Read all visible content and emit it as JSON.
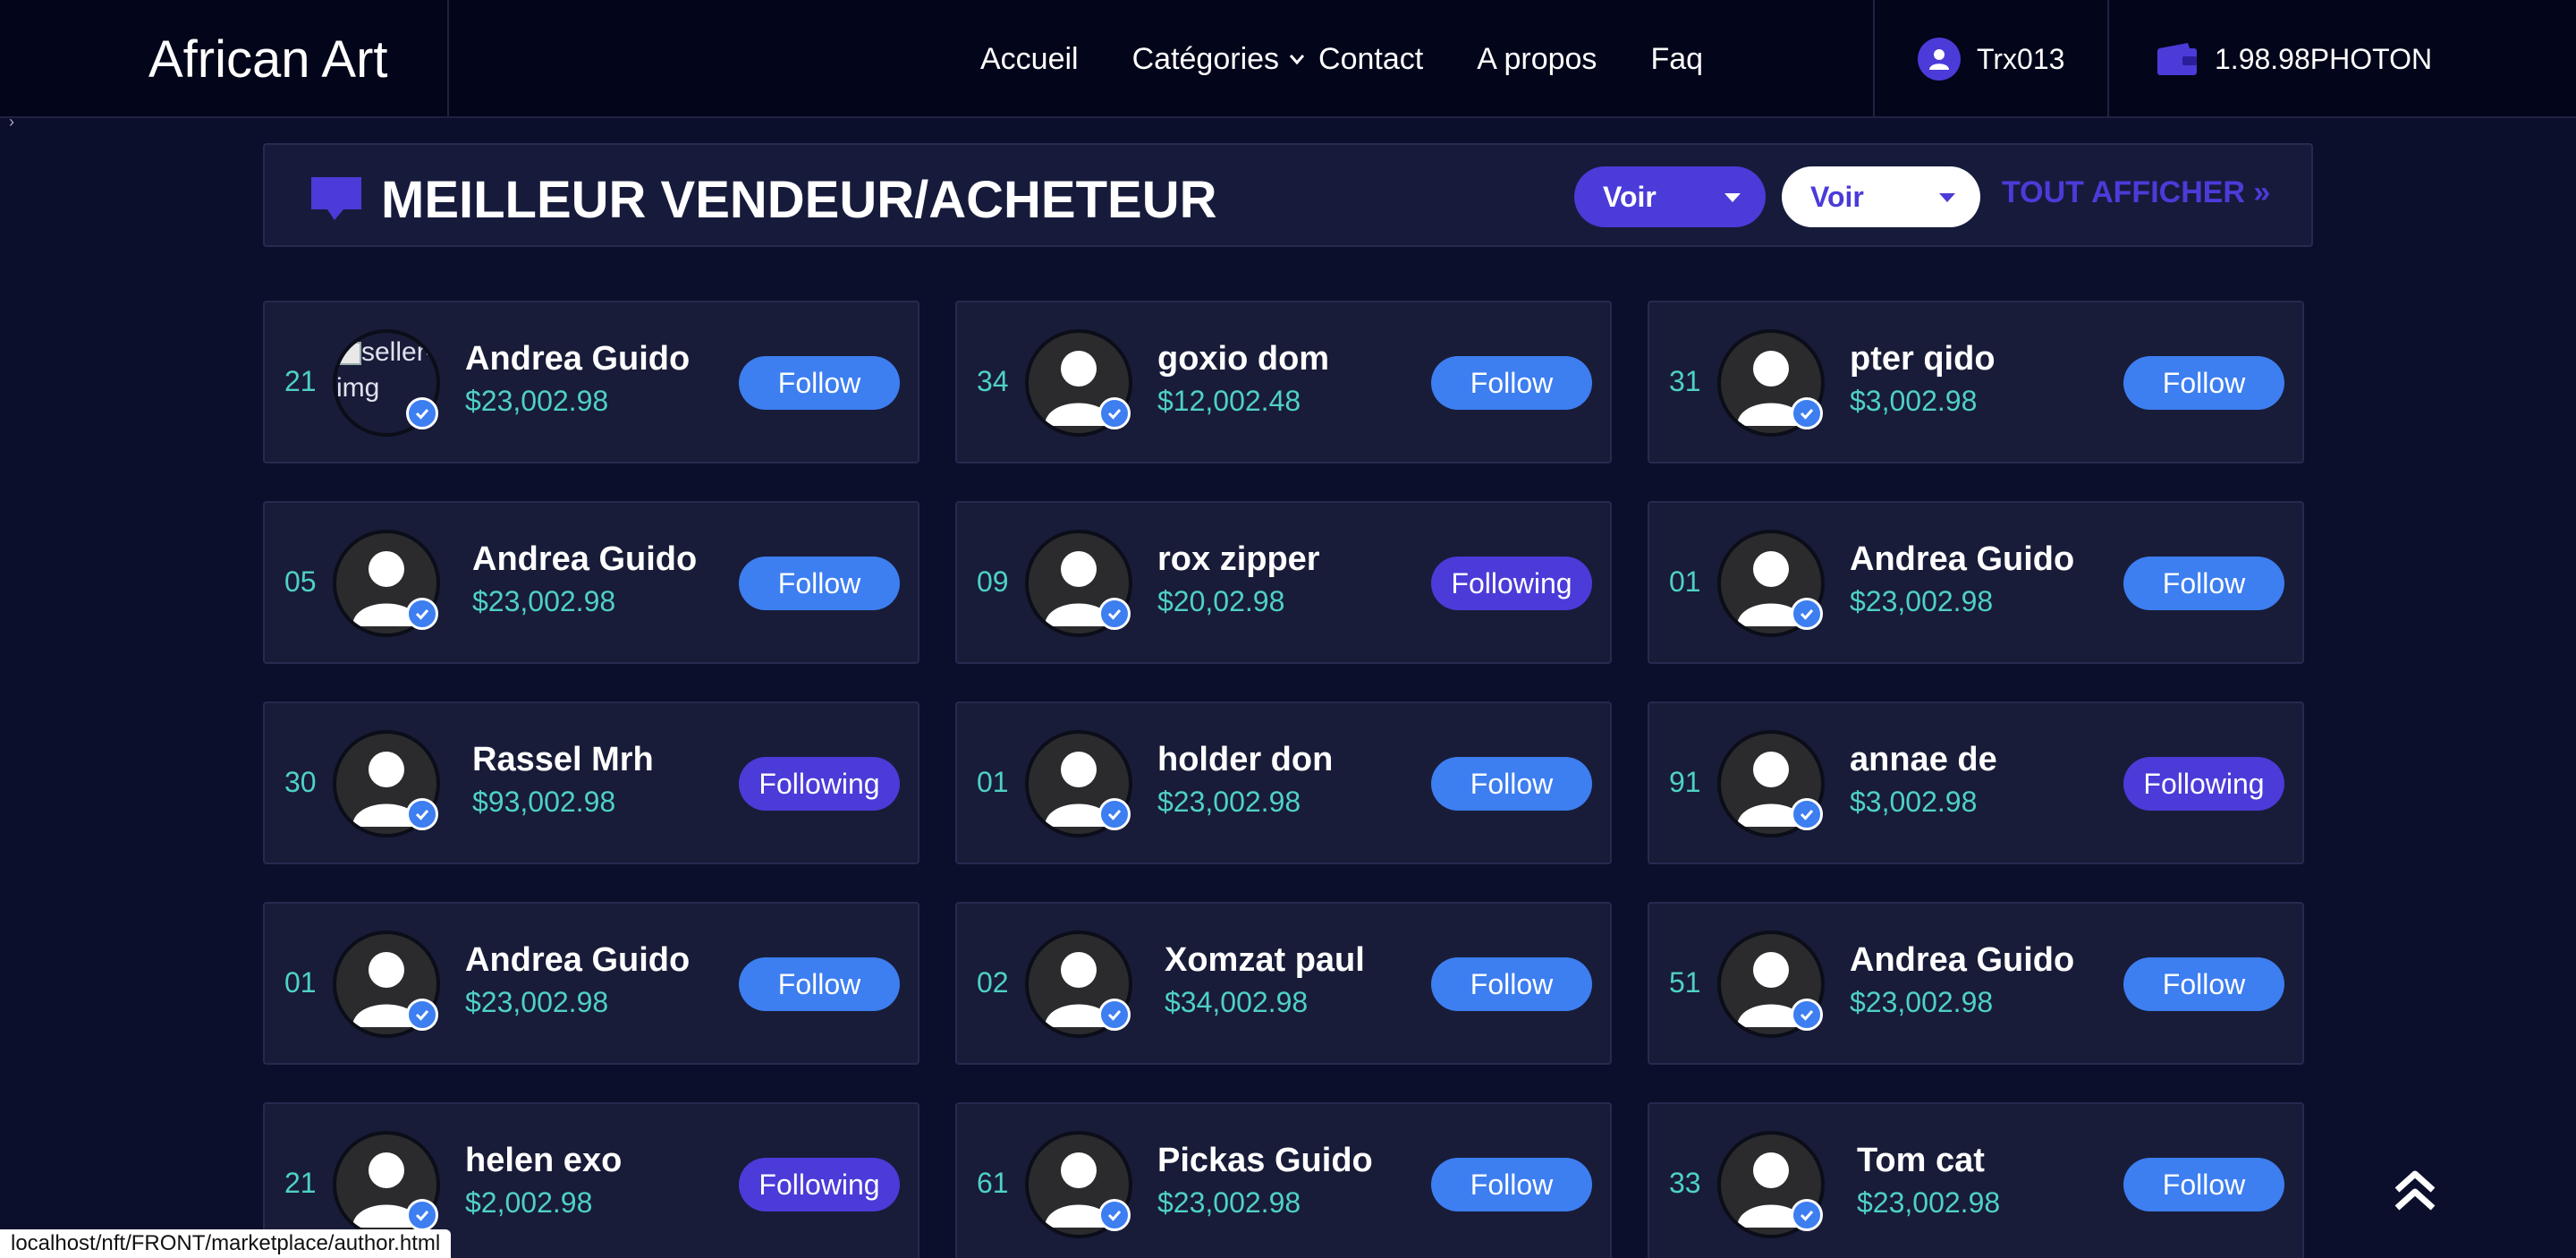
{
  "brand": "African Art",
  "nav": {
    "items": [
      "Accueil",
      "Catégories",
      "Contact",
      "A propos",
      "Faq"
    ]
  },
  "user": {
    "name": "Trx013"
  },
  "wallet": {
    "balance": "1.98.98PHOTON"
  },
  "section": {
    "title": "MEILLEUR VENDEUR/ACHETEUR",
    "select1": "Voir",
    "select2": "Voir",
    "view_all": "TOUT AFFICHER »"
  },
  "sellers": [
    {
      "rank": "21",
      "name": "Andrea Guido",
      "amount": "$23,002.98",
      "button": "Follow",
      "state": "follow",
      "broken_img": true,
      "alt": "seller-img"
    },
    {
      "rank": "34",
      "name": "goxio dom",
      "amount": "$12,002.48",
      "button": "Follow",
      "state": "follow"
    },
    {
      "rank": "31",
      "name": "pter qido",
      "amount": "$3,002.98",
      "button": "Follow",
      "state": "follow"
    },
    {
      "rank": "05",
      "name": "Andrea Guido",
      "amount": "$23,002.98",
      "button": "Follow",
      "state": "follow"
    },
    {
      "rank": "09",
      "name": "rox zipper",
      "amount": "$20,02.98",
      "button": "Following",
      "state": "following"
    },
    {
      "rank": "01",
      "name": "Andrea Guido",
      "amount": "$23,002.98",
      "button": "Follow",
      "state": "follow"
    },
    {
      "rank": "30",
      "name": "Rassel Mrh",
      "amount": "$93,002.98",
      "button": "Following",
      "state": "following"
    },
    {
      "rank": "01",
      "name": "holder don",
      "amount": "$23,002.98",
      "button": "Follow",
      "state": "follow"
    },
    {
      "rank": "91",
      "name": "annae de",
      "amount": "$3,002.98",
      "button": "Following",
      "state": "following"
    },
    {
      "rank": "01",
      "name": "Andrea Guido",
      "amount": "$23,002.98",
      "button": "Follow",
      "state": "follow"
    },
    {
      "rank": "02",
      "name": "Xomzat paul",
      "amount": "$34,002.98",
      "button": "Follow",
      "state": "follow"
    },
    {
      "rank": "51",
      "name": "Andrea Guido",
      "amount": "$23,002.98",
      "button": "Follow",
      "state": "follow"
    },
    {
      "rank": "21",
      "name": "helen exo",
      "amount": "$2,002.98",
      "button": "Following",
      "state": "following"
    },
    {
      "rank": "61",
      "name": "Pickas Guido",
      "amount": "$23,002.98",
      "button": "Follow",
      "state": "follow"
    },
    {
      "rank": "33",
      "name": "Tom cat",
      "amount": "$23,002.98",
      "button": "Follow",
      "state": "follow"
    }
  ],
  "status_url": "localhost/nft/FRONT/marketplace/author.html",
  "icons": {
    "section": "chat-bubble-icon",
    "user": "user-icon",
    "wallet": "wallet-icon",
    "verified": "check-badge-icon",
    "scroll_top": "double-chevron-up-icon"
  },
  "colors": {
    "background": "#0c0f2c",
    "header": "#03051a",
    "accent_purple": "#4b3bd8",
    "follow_blue": "#3d7ef0",
    "amount_teal": "#4fd1c5"
  }
}
